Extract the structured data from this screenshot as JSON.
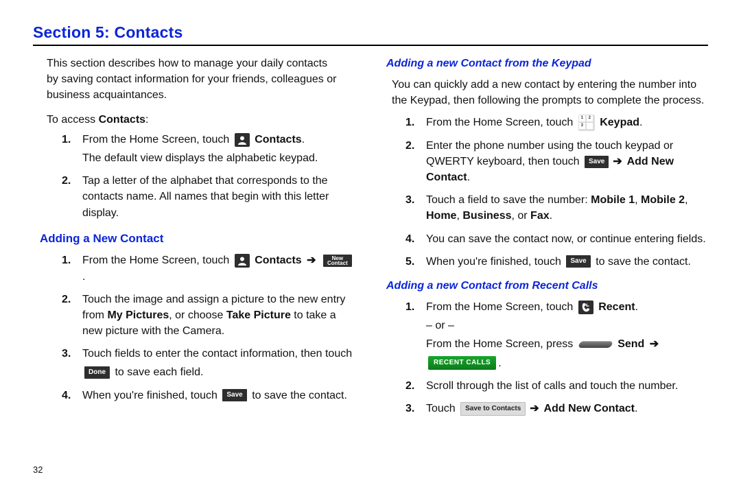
{
  "section_title": "Section 5: Contacts",
  "intro": "This section describes how to manage your daily contacts by saving contact information for your friends, colleagues or business acquaintances.",
  "access_lead_pre": "To access ",
  "access_lead_bold": "Contacts",
  "access_lead_post": ":",
  "left": {
    "s1_pre": "From the Home Screen, touch ",
    "s1_bold": " Contacts",
    "s1_post": ".",
    "s1_line2": "The default view displays the alphabetic keypad.",
    "s2": "Tap a letter of the alphabet that corresponds to the contacts name. All names that begin with this letter display."
  },
  "h2_add": "Adding a New Contact",
  "add": {
    "s1_pre": "From the Home Screen, touch ",
    "s1_bold": " Contacts ",
    "s1_post": " .",
    "s2_a": "Touch the image and assign a picture to the new entry from ",
    "s2_myp": "My Pictures",
    "s2_b": ", or choose ",
    "s2_take": "Take Picture",
    "s2_c": " to take a new picture with the Camera.",
    "s3_pre": "Touch fields to enter the contact information, then touch ",
    "s3_post": " to save each field.",
    "s4_pre": "When you're finished, touch ",
    "s4_post": " to save the contact."
  },
  "h3_keypad": "Adding a new Contact from the Keypad",
  "keypad": {
    "intro": "You can quickly add a new contact by entering the number into the Keypad, then following the prompts to complete the process.",
    "s1_pre": "From the Home Screen, touch ",
    "s1_bold": " Keypad",
    "s1_post": ".",
    "s2_pre": "Enter the phone number using the touch keypad or QWERTY keyboard, then touch ",
    "s2_bold": " Add New Contact",
    "s2_post": ".",
    "s3_pre": "Touch a field to save the number: ",
    "s3_m1": "Mobile 1",
    "s3_m2": "Mobile 2",
    "s3_home": "Home",
    "s3_bus": "Business",
    "s3_fax": "Fax",
    "s3_or": ", or ",
    "s3_period": ".",
    "s3_comma": ", ",
    "s4": "You can save the contact now, or continue entering fields.",
    "s5_pre": "When you're finished, touch ",
    "s5_post": " to save the contact."
  },
  "h3_recent": "Adding a new Contact from Recent Calls",
  "recent": {
    "s1_pre": "From the Home Screen, touch ",
    "s1_bold": " Recent",
    "s1_post": ".",
    "s1_or": "– or –",
    "s1b_pre": "From the Home Screen, press ",
    "s1b_bold": " Send ",
    "s1b_post": ".",
    "s2": "Scroll through the list of calls and touch the number.",
    "s3_pre": "Touch ",
    "s3_bold": " Add New Contact",
    "s3_post": "."
  },
  "icons": {
    "new_contact_l1": "New",
    "new_contact_l2": "Contact",
    "done": "Done",
    "save": "Save",
    "save_to_contacts": "Save to Contacts",
    "recent_calls": "RECENT CALLS"
  },
  "arrow": "➔",
  "nums": {
    "n1": "1.",
    "n2": "2.",
    "n3": "3.",
    "n4": "4.",
    "n5": "5."
  },
  "page_number": "32"
}
